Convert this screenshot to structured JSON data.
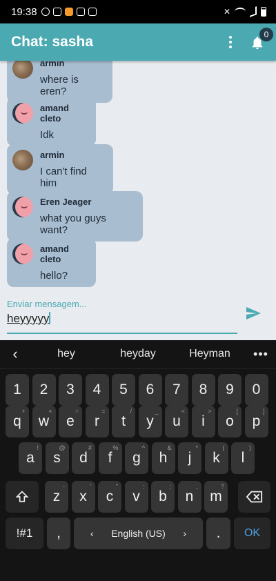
{
  "status": {
    "time": "19:38"
  },
  "appbar": {
    "title": "Chat: sasha",
    "badge": "0",
    "menu_icon": "more-vert-icon",
    "bell_icon": "notifications-icon"
  },
  "messages": [
    {
      "sender": "armin",
      "text": "where is eren?",
      "avatar": "photo"
    },
    {
      "sender": "amand cleto",
      "text": "Idk",
      "avatar": "pink"
    },
    {
      "sender": "armin",
      "text": "I can't find him",
      "avatar": "photo"
    },
    {
      "sender": "Eren Jeager",
      "text": "what you guys want?",
      "avatar": "pink"
    },
    {
      "sender": "amand cleto",
      "text": "hello?",
      "avatar": "pink"
    }
  ],
  "input": {
    "label": "Enviar mensagem...",
    "value": "heyyyyy",
    "send_icon": "send-icon"
  },
  "keyboard": {
    "suggestions": [
      "hey",
      "heyday",
      "Heyman"
    ],
    "numbers": [
      "1",
      "2",
      "3",
      "4",
      "5",
      "6",
      "7",
      "8",
      "9",
      "0"
    ],
    "row1": [
      "q",
      "w",
      "e",
      "r",
      "t",
      "y",
      "u",
      "i",
      "o",
      "p"
    ],
    "row1_hints": [
      "+",
      "×",
      "÷",
      "=",
      "/",
      "_",
      "<",
      ">",
      "[",
      "]"
    ],
    "row2": [
      "a",
      "s",
      "d",
      "f",
      "g",
      "h",
      "j",
      "k",
      "l"
    ],
    "row2_hints": [
      "!",
      "@",
      "#",
      "%",
      "^",
      "&",
      "*",
      "(",
      ")"
    ],
    "row3": [
      "z",
      "x",
      "c",
      "v",
      "b",
      "n",
      "m"
    ],
    "row3_hints": [
      "-",
      "'",
      "\"",
      ":",
      ";",
      ",",
      "?"
    ],
    "sym_label": "!#1",
    "comma": ",",
    "space_label": "English (US)",
    "period": ".",
    "ok_label": "OK"
  }
}
